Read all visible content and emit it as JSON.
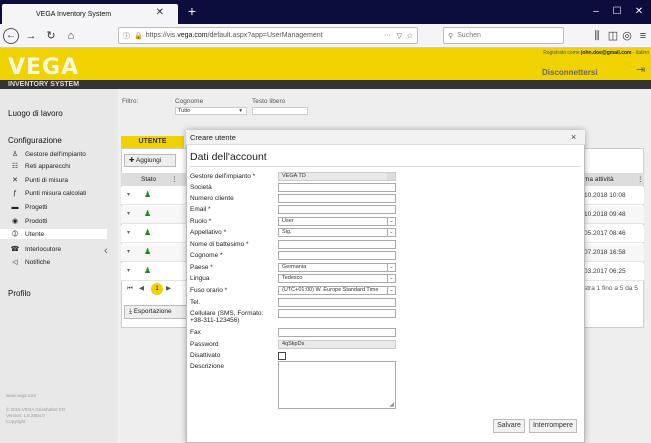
{
  "browser": {
    "tab_title": "VEGA Inventory System",
    "url_prefix": "https://vis.",
    "url_domain": "vega.com",
    "url_suffix": "/default.aspx?app=UserManagement",
    "search_placeholder": "Suchen",
    "url_dots": "···"
  },
  "header": {
    "logo": "VEGA",
    "subtitle": "INVENTORY SYSTEM",
    "registered_prefix": "Registrato come",
    "registered_email": "john.doe@gmail.com",
    "registered_suffix": "- italino",
    "logout": "Disconnettersi"
  },
  "sidebar": {
    "section1": "Luogo di lavoro",
    "section2": "Configurazione",
    "items": [
      {
        "label": "Gestore dell'impianto",
        "icon": "♙"
      },
      {
        "label": "Reti apparecchi",
        "icon": "☷"
      },
      {
        "label": "Punti di misura",
        "icon": "✕"
      },
      {
        "label": "Punti misura calcolati",
        "icon": "ƒ"
      },
      {
        "label": "Progetti",
        "icon": "▬"
      },
      {
        "label": "Prodotti",
        "icon": "◉"
      },
      {
        "label": "Utente",
        "icon": "➀"
      },
      {
        "label": "Interlocutore",
        "icon": "☎"
      },
      {
        "label": "Notifiche",
        "icon": "◁"
      }
    ],
    "section3": "Profilo",
    "footer1": "www.vega.com",
    "footer2": "© 2018 VEGA Grieshaber KG",
    "footer3": "Version: 1.6.2804.0",
    "footer4": "Copyright"
  },
  "filters": {
    "filter_label": "Filtro:",
    "name_label": "Cognome",
    "name_value": "Tutto",
    "text_label": "Testo libero"
  },
  "grid": {
    "tab": "UTENTE",
    "add_button": "Aggiungi",
    "col_state": "Stato",
    "col_activity": "ma attività",
    "rows": [
      {
        "date": "10.2018 10:08"
      },
      {
        "date": "10.2018 09:48"
      },
      {
        "date": "05.2017 08:46"
      },
      {
        "date": "07.2018 16:58"
      },
      {
        "date": "03.2017 06:25"
      }
    ],
    "current_page": "1",
    "pager_text": "stra 1 fino a 5 da 5",
    "export_button": "Esportazione"
  },
  "dialog": {
    "title": "Creare utente",
    "close": "×",
    "heading": "Dati dell'account",
    "fields": {
      "operator_label": "Gestore dell'impianto *",
      "operator_value": "VEGA TD",
      "company_label": "Società",
      "customer_label": "Numero cliente",
      "email_label": "Email *",
      "role_label": "Ruolo *",
      "role_value": "User",
      "salutation_label": "Appellativo *",
      "salutation_value": "Sig.",
      "firstname_label": "Nome di battesimo *",
      "lastname_label": "Cognome *",
      "country_label": "Paese *",
      "country_value": "Germania",
      "language_label": "Lingua",
      "language_value": "Tedesco",
      "timezone_label": "Fuso orario *",
      "timezone_value": "(UTC+01:00) W. Europe Standard Time",
      "phone_label": "Tel.",
      "mobile_label": "Cellulare (SMS, Formato: +38-311-123456)",
      "fax_label": "Fax",
      "password_label": "Password",
      "password_value": "4qSkpDs",
      "disabled_label": "Disattivato",
      "description_label": "Descrizione"
    },
    "save_button": "Salvare",
    "cancel_button": "Interrompere"
  },
  "colors": {
    "brand_yellow": "#f0d200",
    "chrome_dark": "#0c0c3d"
  }
}
